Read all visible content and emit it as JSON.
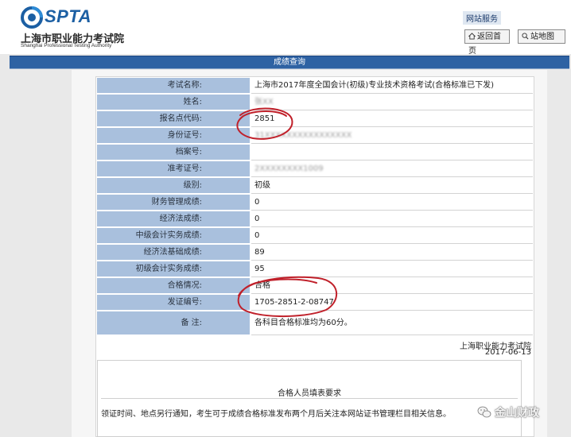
{
  "brand": {
    "logo_text": "SPTA",
    "name_cn": "上海市职业能力考试院",
    "name_en": "Shanghai Professional Testing Authority"
  },
  "header": {
    "service_label": "网站服务",
    "home_button": "返回首页",
    "sitemap_button": "站地图",
    "home_icon": "home-icon",
    "sitemap_icon": "magnifier-icon"
  },
  "nav": {
    "title": "成绩查询"
  },
  "result": {
    "rows": [
      {
        "label": "考试名称:",
        "value": "上海市2017年度全国会计(初级)专业技术资格考试(合格标准已下发)"
      },
      {
        "label": "姓名:",
        "value": ""
      },
      {
        "label": "报名点代码:",
        "value": "2851"
      },
      {
        "label": "身份证号:",
        "value": ""
      },
      {
        "label": "档案号:",
        "value": ""
      },
      {
        "label": "准考证号:",
        "value": ""
      },
      {
        "label": "级别:",
        "value": "初级"
      },
      {
        "label": "财务管理成绩:",
        "value": "0"
      },
      {
        "label": "经济法成绩:",
        "value": "0"
      },
      {
        "label": "中级会计实务成绩:",
        "value": "0"
      },
      {
        "label": "经济法基础成绩:",
        "value": "89"
      },
      {
        "label": "初级会计实务成绩:",
        "value": "95"
      },
      {
        "label": "合格情况:",
        "value": "合格"
      },
      {
        "label": "发证编号:",
        "value": "1705-2851-2-08747"
      },
      {
        "label": "备 注:",
        "value": "各科目合格标准均为60分。"
      }
    ],
    "redacted": {
      "name": "张XX",
      "id_number": "31XXXXXXXXXXXXXXXX",
      "ticket": "2XXXXXXXX1009"
    }
  },
  "issuer": {
    "org": "上海职业能力考试院",
    "date": "2017-06-13"
  },
  "notice": {
    "title": "合格人员填表要求",
    "text": "领证时间、地点另行通知，考生可于成绩合格标准发布两个月后关注本网站证书管理栏目相关信息。"
  },
  "watermark": {
    "text": "金山财政",
    "icon": "wechat-icon"
  },
  "colors": {
    "label_bg": "#a9c0dd",
    "nav_bg": "#2e62a3",
    "brand_blue": "#1c5fa3",
    "annotation": "#c0202a"
  }
}
